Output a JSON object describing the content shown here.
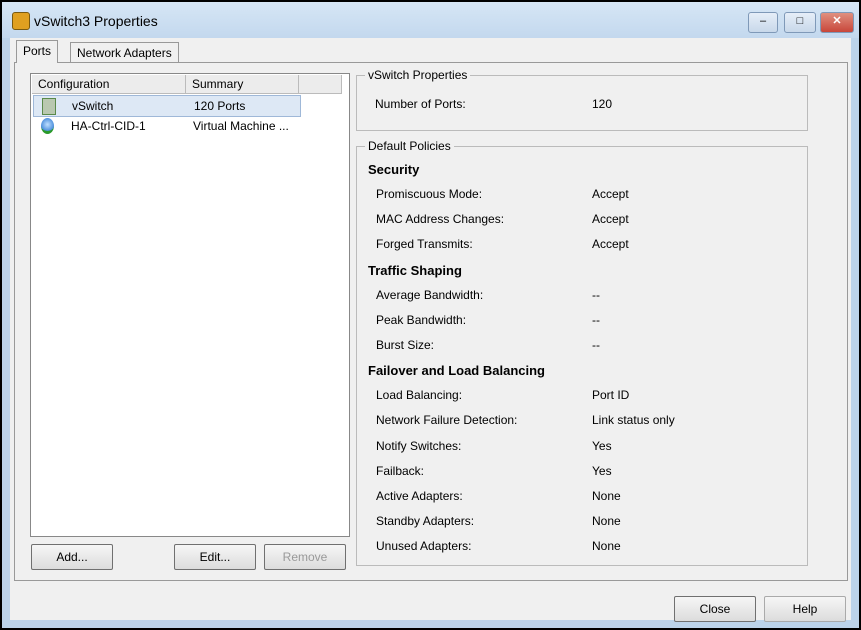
{
  "window": {
    "title": "vSwitch3 Properties",
    "minimize": "–",
    "maximize": "□",
    "close": "✕",
    "close_color": "#c8463a"
  },
  "tabs": [
    {
      "label": "Ports",
      "active": true
    },
    {
      "label": "Network Adapters",
      "active": false
    }
  ],
  "list": {
    "columns": [
      "Configuration",
      "Summary"
    ],
    "rows": [
      {
        "icon": "vswitch-icon",
        "config": "vSwitch",
        "summary": "120 Ports",
        "selected": true
      },
      {
        "icon": "port-group-globe-icon",
        "config": "HA-Ctrl-CID-1",
        "summary": "Virtual Machine ..."
      }
    ]
  },
  "list_buttons": {
    "add": "Add...",
    "edit": "Edit...",
    "remove": "Remove"
  },
  "vswitch_properties": {
    "title": "vSwitch Properties",
    "label": "Number of Ports:",
    "value": "120"
  },
  "default_policies": {
    "title": "Default Policies",
    "sections": [
      {
        "title": "Security",
        "items": [
          {
            "label": "Promiscuous Mode:",
            "value": "Accept"
          },
          {
            "label": "MAC Address Changes:",
            "value": "Accept"
          },
          {
            "label": "Forged Transmits:",
            "value": "Accept"
          }
        ]
      },
      {
        "title": "Traffic Shaping",
        "items": [
          {
            "label": "Average Bandwidth:",
            "value": "--"
          },
          {
            "label": "Peak Bandwidth:",
            "value": "--"
          },
          {
            "label": "Burst Size:",
            "value": "--"
          }
        ]
      },
      {
        "title": "Failover and Load Balancing",
        "items": [
          {
            "label": "Load Balancing:",
            "value": "Port ID"
          },
          {
            "label": "Network Failure Detection:",
            "value": "Link status only"
          },
          {
            "label": "Notify Switches:",
            "value": "Yes"
          },
          {
            "label": "Failback:",
            "value": "Yes"
          },
          {
            "label": "Active Adapters:",
            "value": "None"
          },
          {
            "label": "Standby Adapters:",
            "value": "None"
          },
          {
            "label": "Unused Adapters:",
            "value": "None"
          }
        ]
      }
    ]
  },
  "footer": {
    "close": "Close",
    "help": "Help"
  }
}
